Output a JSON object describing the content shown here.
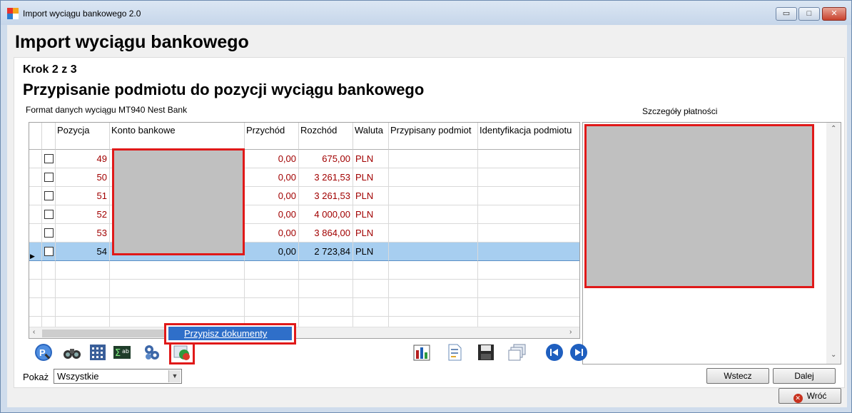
{
  "window": {
    "title": "Import wyciągu bankowego 2.0",
    "minimize": "▭",
    "maximize": "□",
    "close": "✕"
  },
  "header": {
    "title": "Import wyciągu bankowego"
  },
  "step": {
    "label": "Krok 2 z 3",
    "title": "Przypisanie podmiotu do pozycji wyciągu bankowego",
    "format_label": "Format danych wyciągu  MT940 Nest Bank"
  },
  "details": {
    "label": "Szczegóły płatności"
  },
  "grid": {
    "columns": [
      "Pozycja",
      "Konto bankowe",
      "Przychód",
      "Rozchód",
      "Waluta",
      "Przypisany podmiot",
      "Identyfikacja podmiotu"
    ],
    "rows": [
      {
        "pos": "49",
        "income": "0,00",
        "expense": "675,00",
        "currency": "PLN"
      },
      {
        "pos": "50",
        "income": "0,00",
        "expense": "3 261,53",
        "currency": "PLN"
      },
      {
        "pos": "51",
        "income": "0,00",
        "expense": "3 261,53",
        "currency": "PLN"
      },
      {
        "pos": "52",
        "income": "0,00",
        "expense": "4 000,00",
        "currency": "PLN"
      },
      {
        "pos": "53",
        "income": "0,00",
        "expense": "3 864,00",
        "currency": "PLN"
      },
      {
        "pos": "54",
        "income": "0,00",
        "expense": "2 723,84",
        "currency": "PLN"
      }
    ]
  },
  "context_menu": {
    "item": "Przypisz dokumenty"
  },
  "filter": {
    "label": "Pokaż",
    "value": "Wszystkie"
  },
  "buttons": {
    "back": "Wstecz",
    "next": "Dalej",
    "return": "Wróć"
  },
  "icons": {
    "toolbar": [
      "search-icon",
      "binoculars-icon",
      "calculator-icon",
      "sum-icon",
      "gears-icon",
      "assign-icon",
      "chart-icon",
      "document-icon",
      "save-icon",
      "windows-icon",
      "first-icon",
      "last-icon"
    ]
  }
}
